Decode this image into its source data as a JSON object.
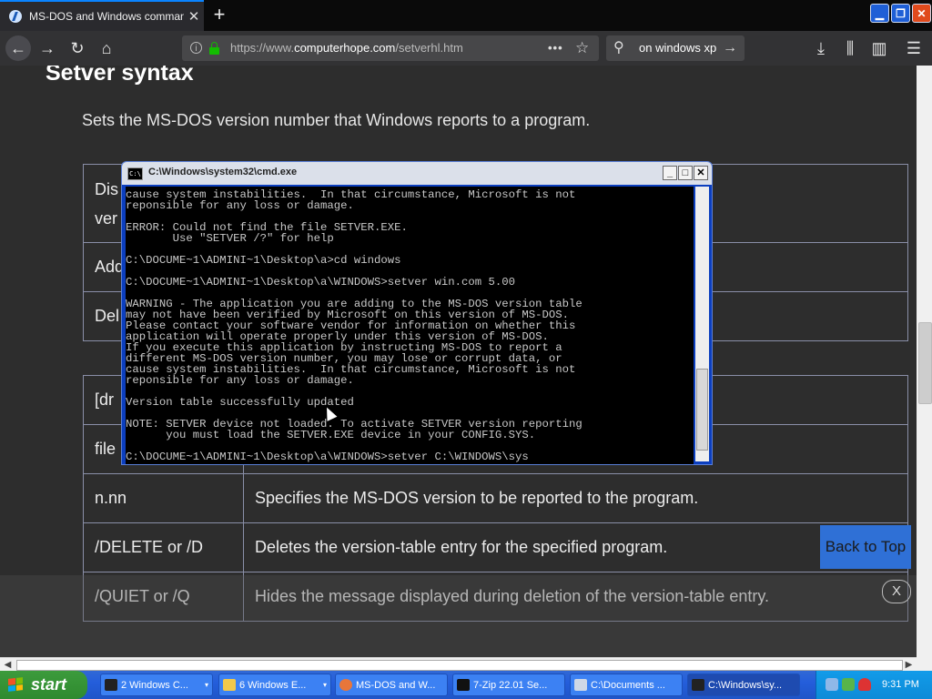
{
  "browser": {
    "tab": {
      "title": "MS-DOS and Windows command l",
      "close": "✕"
    },
    "new_tab": "+",
    "window_buttons": {
      "minimize": "▁",
      "restore": "❐",
      "close": "✕"
    },
    "nav": {
      "back": "←",
      "forward": "→",
      "reload": "↻",
      "home": "⌂"
    },
    "url": {
      "prefix": "https://www.",
      "domain": "computerhope.com",
      "path": "/setverhl.htm",
      "actions": "•••",
      "bookmark": "☆"
    },
    "search": {
      "icon": "⚲",
      "text": "on windows xp",
      "go": "→"
    },
    "toolbar": {
      "download": "⤓",
      "library": "⫼",
      "sidebar": "▥",
      "menu": "☰"
    }
  },
  "page": {
    "heading": "Setver syntax",
    "description": "Sets the MS-DOS version number that Windows reports to a program.",
    "table1": [
      {
        "c1": "Dis\nver",
        "c2": ""
      },
      {
        "c1": "Add",
        "c2": ""
      },
      {
        "c1": "Del",
        "c2": ""
      }
    ],
    "table2": [
      {
        "c1": "[dr",
        "c2": ""
      },
      {
        "c1": "file",
        "c2": ""
      },
      {
        "c1": "n.nn",
        "c2": "Specifies the MS-DOS version to be reported to the program."
      },
      {
        "c1": "/DELETE or /D",
        "c2": "Deletes the version-table entry for the specified program."
      },
      {
        "c1": "/QUIET or /Q",
        "c2": "Hides the message displayed during deletion of the version-table entry."
      }
    ],
    "back_to_top": "Back to Top",
    "close_x": "X"
  },
  "cmd": {
    "title": "C:\\Windows\\system32\\cmd.exe",
    "icon_text": "C:\\",
    "buttons": {
      "minimize": "_",
      "maximize": "□",
      "close": "✕"
    },
    "output": "cause system instabilities.  In that circumstance, Microsoft is not\nreponsible for any loss or damage.\n\nERROR: Could not find the file SETVER.EXE.\n       Use \"SETVER /?\" for help\n\nC:\\DOCUME~1\\ADMINI~1\\Desktop\\a>cd windows\n\nC:\\DOCUME~1\\ADMINI~1\\Desktop\\a\\WINDOWS>setver win.com 5.00\n\nWARNING - The application you are adding to the MS-DOS version table\nmay not have been verified by Microsoft on this version of MS-DOS.\nPlease contact your software vendor for information on whether this\napplication will operate properly under this version of MS-DOS.\nIf you execute this application by instructing MS-DOS to report a\ndifferent MS-DOS version number, you may lose or corrupt data, or\ncause system instabilities.  In that circumstance, Microsoft is not\nreponsible for any loss or damage.\n\nVersion table successfully updated\n\nNOTE: SETVER device not loaded. To activate SETVER version reporting\n      you must load the SETVER.EXE device in your CONFIG.SYS.\n\nC:\\DOCUME~1\\ADMINI~1\\Desktop\\a\\WINDOWS>setver C:\\WINDOWS\\sys"
  },
  "scrollbar": {
    "left": "◀",
    "right": "▶"
  },
  "taskbar": {
    "start": "start",
    "buttons": [
      {
        "label": "2 Windows C...",
        "dropdown": "▾"
      },
      {
        "label": "6 Windows E...",
        "dropdown": "▾"
      },
      {
        "label": "MS-DOS and W..."
      },
      {
        "label": "7-Zip 22.01 Se..."
      },
      {
        "label": "C:\\Documents ..."
      },
      {
        "label": "C:\\Windows\\sy..."
      }
    ],
    "time": "9:31 PM"
  },
  "colors": {
    "accent": "#0a84ff",
    "back_to_top": "#2f70d6",
    "xp_taskbar": "#245edb",
    "start": "#2f8a2f",
    "lock": "#12bc00"
  }
}
